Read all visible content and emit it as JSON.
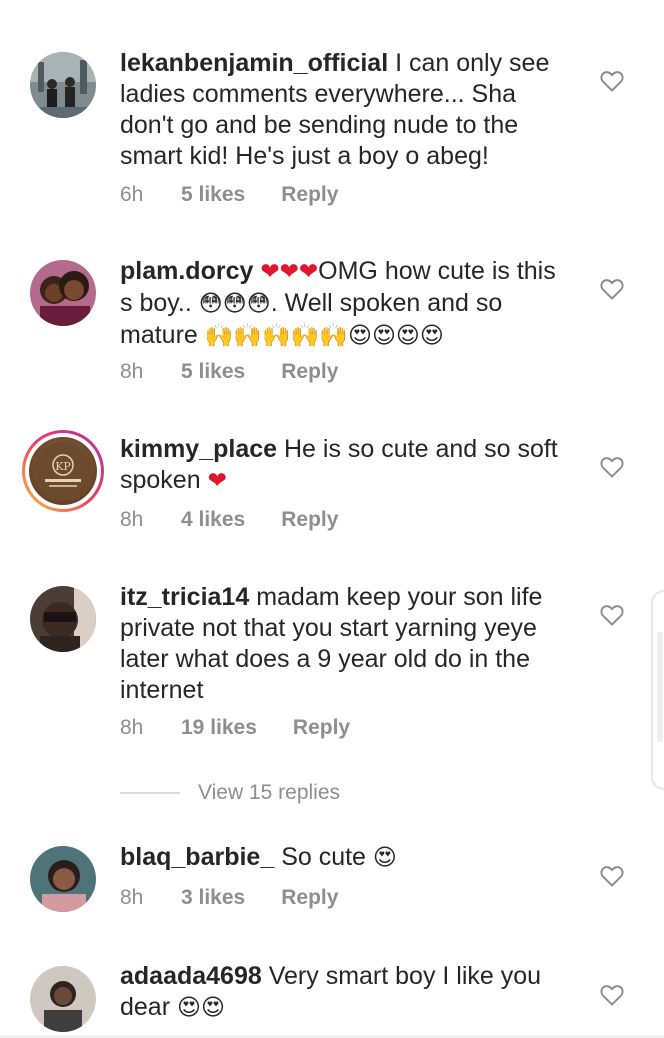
{
  "comments": [
    {
      "username": "lekanbenjamin_official",
      "text": "I can only see ladies comments everywhere... Sha don't go and be sending nude to the smart kid! He's just a boy o abeg!",
      "time": "6h",
      "likes": "5 likes",
      "reply": "Reply",
      "avatar_colors": [
        "#5c6b74",
        "#9aa6a8"
      ]
    },
    {
      "username": "plam.dorcy",
      "text_before": "OMG how cute is this s boy..",
      "text_after": ". Well spoken and so mature",
      "emoji_hearts": "❤❤❤",
      "emoji_flushed": "😳😳😳",
      "emoji_hands": "🙌🙌🙌🙌🙌",
      "emoji_love": "😍😍😍😍",
      "time": "8h",
      "likes": "5 likes",
      "reply": "Reply",
      "avatar_colors": [
        "#3a2a35",
        "#c25a83"
      ]
    },
    {
      "username": "kimmy_place",
      "text": "He is so cute and so soft spoken",
      "emoji": "❤",
      "time": "8h",
      "likes": "4 likes",
      "reply": "Reply",
      "avatar_label": "KP"
    },
    {
      "username": "itz_tricia14",
      "text": "madam keep your son life private not that you start yarning yeye later what does a 9 year old do in the internet",
      "time": "8h",
      "likes": "19 likes",
      "reply": "Reply",
      "avatar_colors": [
        "#2b2320",
        "#c9b3a4"
      ]
    },
    {
      "username": "blaq_barbie_",
      "text": "So cute",
      "emoji": "😍",
      "time": "8h",
      "likes": "3 likes",
      "reply": "Reply",
      "avatar_colors": [
        "#3c5f66",
        "#d9a7a0"
      ]
    },
    {
      "username": "adaada4698",
      "text": "Very smart boy I like you dear",
      "emoji": "😍😍",
      "avatar_colors": [
        "#b8b0a8",
        "#3b3b3b"
      ]
    }
  ],
  "view_replies": "View 15 replies",
  "icons": {
    "like": "heart-outline-icon"
  },
  "colors": {
    "text": "#262626",
    "muted": "#8e8e8e",
    "heart": "#e0172a"
  }
}
